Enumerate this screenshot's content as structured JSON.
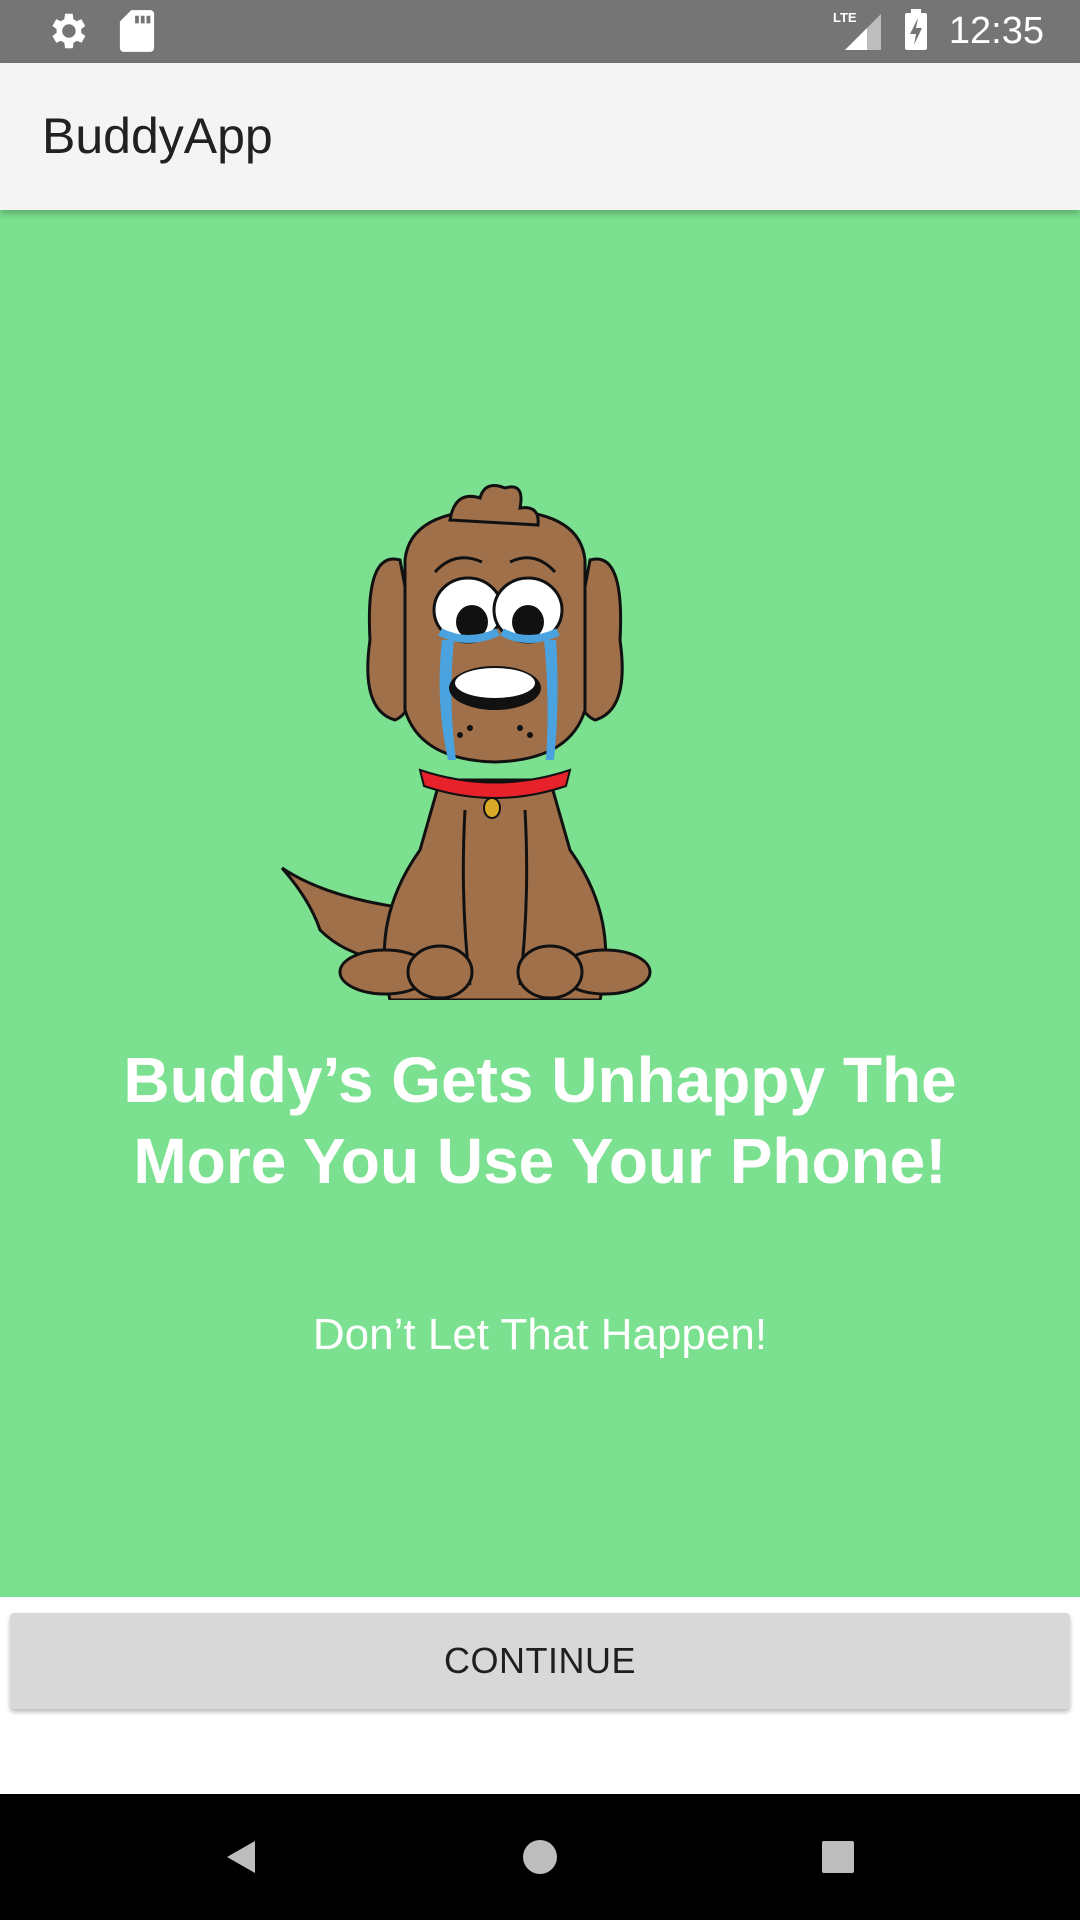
{
  "status_bar": {
    "time": "12:35",
    "network": "LTE",
    "icons": [
      "gear-icon",
      "sd-card-icon",
      "signal-icon",
      "battery-charging-icon"
    ]
  },
  "app_bar": {
    "title": "BuddyApp"
  },
  "main": {
    "headline": "Buddy’s Gets Unhappy The More You Use Your Phone!",
    "subtext": "Don’t Let That Happen!",
    "background": "#7be08f"
  },
  "actions": {
    "continue_label": "CONTINUE"
  },
  "nav_bar": {
    "icons": [
      "back-icon",
      "home-icon",
      "recents-icon"
    ]
  }
}
